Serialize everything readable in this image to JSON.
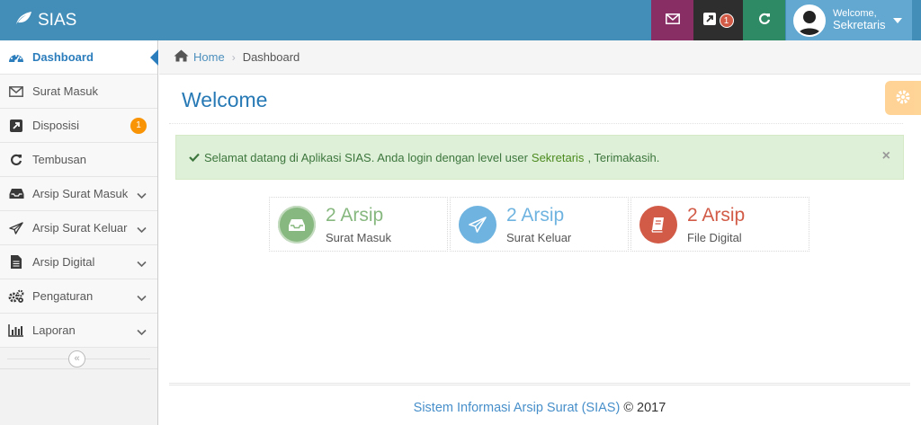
{
  "brand": {
    "name": "SIAS",
    "icon": "leaf-icon"
  },
  "navbar": {
    "mail_icon": "envelope-icon",
    "disposisi_icon": "share-square-icon",
    "disposisi_badge": "1",
    "refresh_icon": "refresh-icon",
    "user": {
      "welcome": "Welcome,",
      "name": "Sekretaris",
      "avatar_icon": "user-avatar-icon"
    },
    "colors": {
      "bar": "#438eb9",
      "mail": "#892e65",
      "disposisi": "#2e2e2e",
      "refresh": "#2e8965",
      "user": "#62a8d1"
    }
  },
  "sidebar": {
    "items": [
      {
        "label": "Dashboard",
        "icon": "tachometer-icon",
        "active": true
      },
      {
        "label": "Surat Masuk",
        "icon": "envelope-icon"
      },
      {
        "label": "Disposisi",
        "icon": "share-square-icon",
        "badge": "1"
      },
      {
        "label": "Tembusan",
        "icon": "refresh-icon"
      },
      {
        "label": "Arsip Surat Masuk",
        "icon": "inbox-icon",
        "submenu": true
      },
      {
        "label": "Arsip Surat Keluar",
        "icon": "paper-plane-icon",
        "submenu": true
      },
      {
        "label": "Arsip Digital",
        "icon": "file-text-icon",
        "submenu": true
      },
      {
        "label": "Pengaturan",
        "icon": "cogs-icon",
        "submenu": true
      },
      {
        "label": "Laporan",
        "icon": "bar-chart-icon",
        "submenu": true
      }
    ],
    "collapse_icon": "double-angle-left-icon"
  },
  "breadcrumb": {
    "home": "Home",
    "current": "Dashboard"
  },
  "page": {
    "title": "Welcome",
    "settings_icon": "cog-icon"
  },
  "alert": {
    "prefix": "Selamat datang di Aplikasi SIAS. Anda login dengan level user",
    "level": "Sekretaris",
    "suffix": ", Terimakasih.",
    "close": "×"
  },
  "infoboxes": [
    {
      "number": "2 Arsip",
      "label": "Surat Masuk",
      "icon": "inbox-icon",
      "color": "#87b87f"
    },
    {
      "number": "2 Arsip",
      "label": "Surat Keluar",
      "icon": "paper-plane-icon",
      "color": "#6fb3e0"
    },
    {
      "number": "2 Arsip",
      "label": "File Digital",
      "icon": "book-icon",
      "color": "#d15b47"
    }
  ],
  "footer": {
    "brand": "Sistem Informasi Arsip Surat (SIAS)",
    "copyright": "© 2017"
  }
}
